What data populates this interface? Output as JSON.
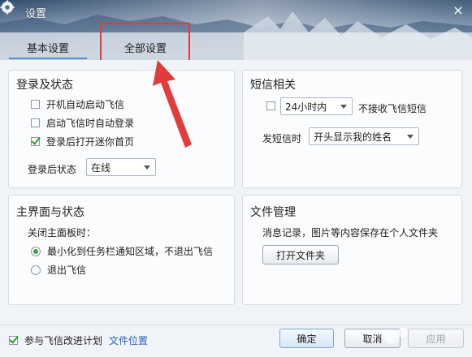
{
  "window": {
    "title": "设置",
    "close_symbol": "×"
  },
  "tabs": [
    {
      "label": "基本设置",
      "active": true
    },
    {
      "label": "全部设置",
      "active": false
    }
  ],
  "login": {
    "title": "登录及状态",
    "options": [
      {
        "label": "开机自动启动飞信",
        "checked": false
      },
      {
        "label": "启动飞信时自动登录",
        "checked": false
      },
      {
        "label": "登录后打开迷你首页",
        "checked": true
      }
    ],
    "status_label": "登录后状态",
    "status_value": "在线"
  },
  "sms": {
    "title": "短信相关",
    "hours_value": "24小时内",
    "no_receive_label": "不接收飞信短信",
    "send_label": "发短信时",
    "send_value": "开头显示我的姓名"
  },
  "main_ui": {
    "title": "主界面与状态",
    "close_label": "关闭主面板时：",
    "options": [
      {
        "label": "最小化到任务栏通知区域，不退出飞信",
        "selected": true
      },
      {
        "label": "退出飞信",
        "selected": false
      }
    ]
  },
  "files": {
    "title": "文件管理",
    "desc": "消息记录，图片等内容保存在个人文件夹",
    "open_button": "打开文件夹"
  },
  "footer": {
    "improve_label": "参与飞信改进计划",
    "file_location": "文件位置",
    "ok": "确定",
    "cancel": "取消",
    "apply": "应用"
  },
  "colors": {
    "accent": "#4e8fd6",
    "annotation": "#e23b3b",
    "check": "#2f9c2f"
  }
}
